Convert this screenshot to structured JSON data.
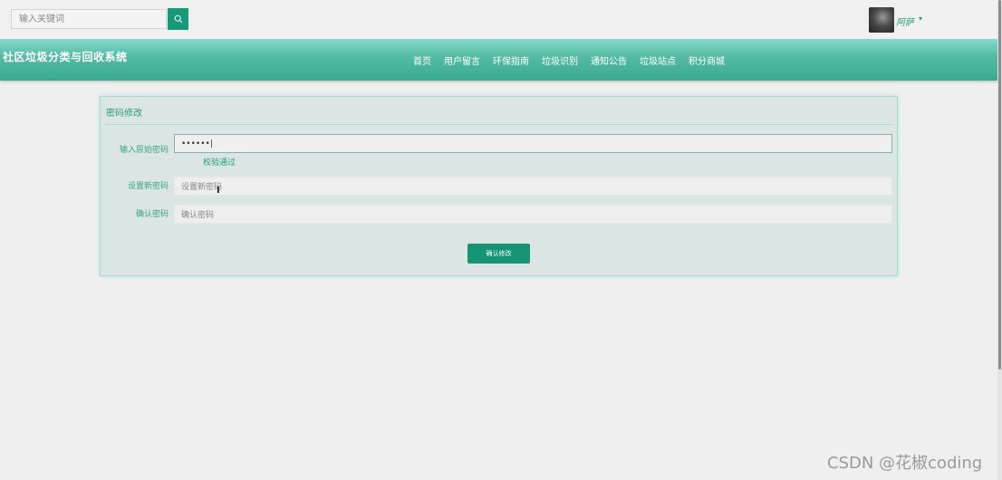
{
  "search": {
    "placeholder": "输入关键词",
    "icon": "search-icon"
  },
  "user": {
    "name": "阿萨",
    "caret": "▾"
  },
  "header": {
    "title": "社区垃圾分类与回收系统",
    "nav": [
      "首页",
      "用户留言",
      "环保指南",
      "垃圾识别",
      "通知公告",
      "垃圾站点",
      "积分商城"
    ]
  },
  "form": {
    "title": "密码修改",
    "old_password": {
      "label": "输入原始密码",
      "value": "••••••|"
    },
    "validation": "校验通过",
    "new_password": {
      "label": "设置新密码",
      "placeholder": "设置新密码"
    },
    "confirm_password": {
      "label": "确认密码",
      "placeholder": "确认密码"
    },
    "submit": "确认修改"
  },
  "watermark": "CSDN @花椒coding",
  "colors": {
    "accent": "#169a79",
    "header": "#56bca4",
    "panel": "#dbe5e4"
  }
}
